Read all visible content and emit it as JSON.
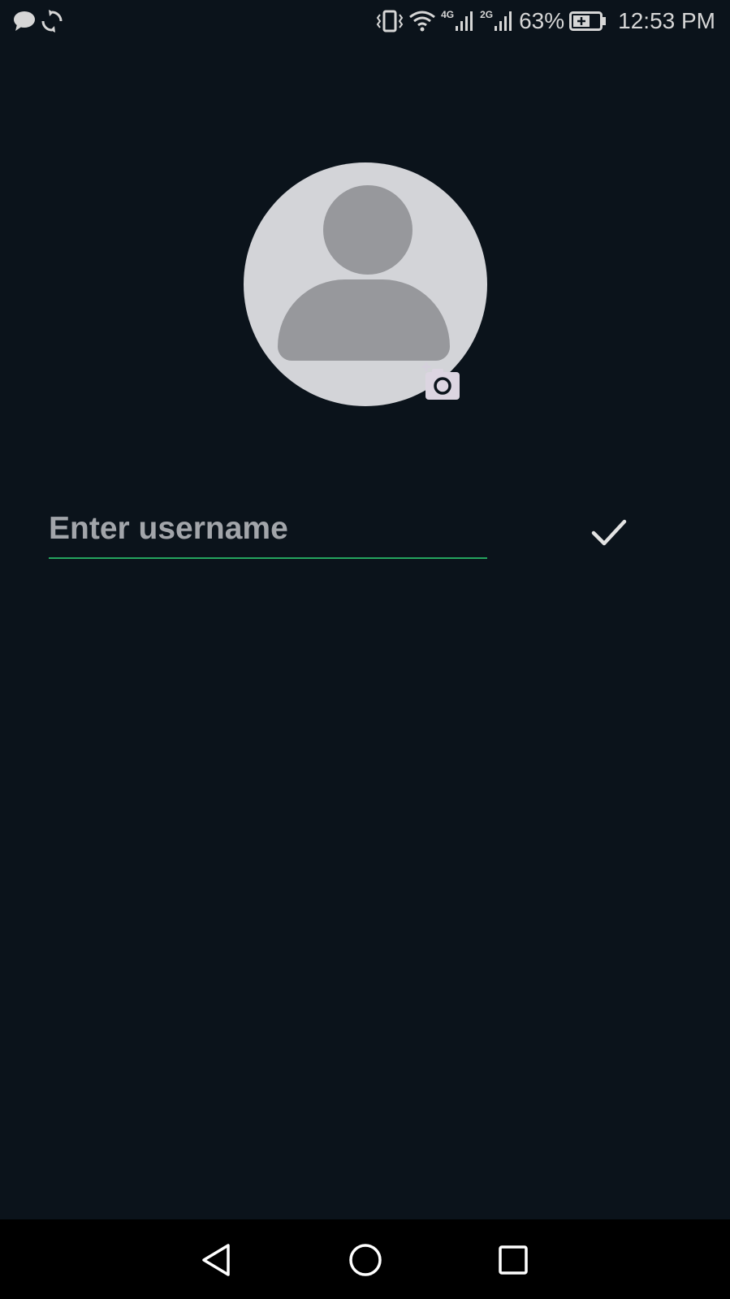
{
  "status_bar": {
    "left_icons": [
      "message-icon",
      "sync-icon"
    ],
    "right_icons": [
      "vibrate-icon",
      "wifi-icon",
      "signal-4g-icon",
      "signal-2g-icon",
      "battery-icon"
    ],
    "network_4g": "4G",
    "network_2g": "2G",
    "battery_percent": "63%",
    "time": "12:53 PM"
  },
  "profile": {
    "avatar_icon": "default-avatar-icon",
    "camera_icon": "add-photo-icon"
  },
  "username": {
    "placeholder": "Enter username",
    "value": "",
    "confirm_icon": "check-icon"
  },
  "nav_bar": {
    "back_icon": "back-triangle-icon",
    "home_icon": "home-circle-icon",
    "recents_icon": "recents-square-icon"
  },
  "colors": {
    "background": "#0b131b",
    "accent": "#25a55f",
    "avatar_bg": "#d3d4d8",
    "avatar_fg": "#97989c",
    "nav_bg": "#000000"
  }
}
